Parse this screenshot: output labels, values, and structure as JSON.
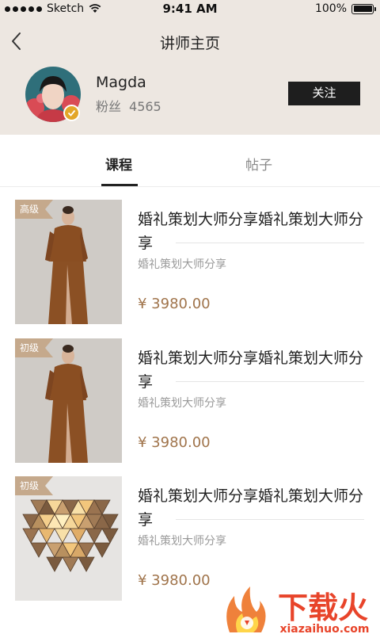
{
  "status_bar": {
    "carrier": "Sketch",
    "time": "9:41 AM",
    "battery": "100%"
  },
  "nav": {
    "title": "讲师主页"
  },
  "profile": {
    "name": "Magda",
    "fans_label": "粉丝",
    "fans_count": "4565",
    "follow_label": "关注"
  },
  "tabs": [
    {
      "label": "课程",
      "active": true
    },
    {
      "label": "帖子",
      "active": false
    }
  ],
  "courses": [
    {
      "tag": "高级",
      "title": "婚礼策划大师分享婚礼策划大师分享",
      "subtitle": "婚礼策划大师分享",
      "price": "¥ 3980.00",
      "image": "model-in-brown-outfit"
    },
    {
      "tag": "初级",
      "title": "婚礼策划大师分享婚礼策划大师分享",
      "subtitle": "婚礼策划大师分享",
      "price": "¥ 3980.00",
      "image": "model-in-brown-outfit"
    },
    {
      "tag": "初级",
      "title": "婚礼策划大师分享婚礼策划大师分享",
      "subtitle": "婚礼策划大师分享",
      "price": "¥ 3980.00",
      "image": "geometric-wooden-lamp"
    }
  ],
  "watermark": {
    "brand": "下载火",
    "url": "xiazaihuo.com"
  },
  "colors": {
    "header_bg": "#ede7e1",
    "price": "#a0744b",
    "tag_bg": "#c5a98c",
    "button_bg": "#1e1e1e",
    "watermark": "#e8442a"
  }
}
